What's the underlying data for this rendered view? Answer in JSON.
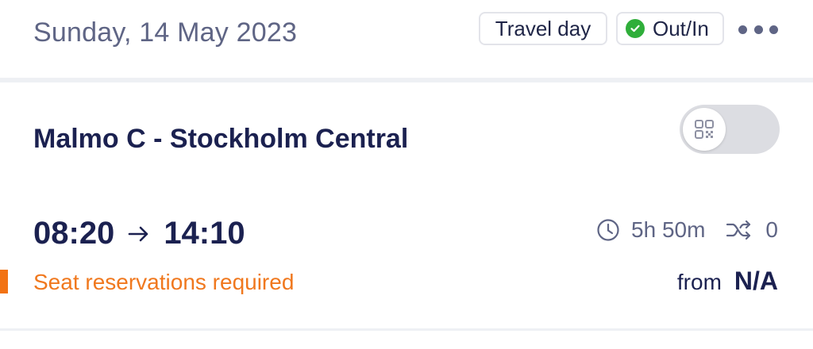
{
  "header": {
    "date": "Sunday, 14 May 2023",
    "badges": {
      "travel_day": "Travel day",
      "out_in": "Out/In"
    },
    "more_icon": "more-dots-icon"
  },
  "journey": {
    "route": "Malmo C - Stockholm Central",
    "toggle_icon": "qr-code-icon",
    "toggle_on": false,
    "departure": "08:20",
    "arrival": "14:10",
    "duration": "5h 50m",
    "changes": "0",
    "notice": "Seat reservations required",
    "price_prefix": "from",
    "price": "N/A"
  },
  "colors": {
    "accent_orange": "#f27314",
    "status_green": "#2fae3a",
    "text_primary": "#1b2150",
    "text_secondary": "#5f6585"
  }
}
